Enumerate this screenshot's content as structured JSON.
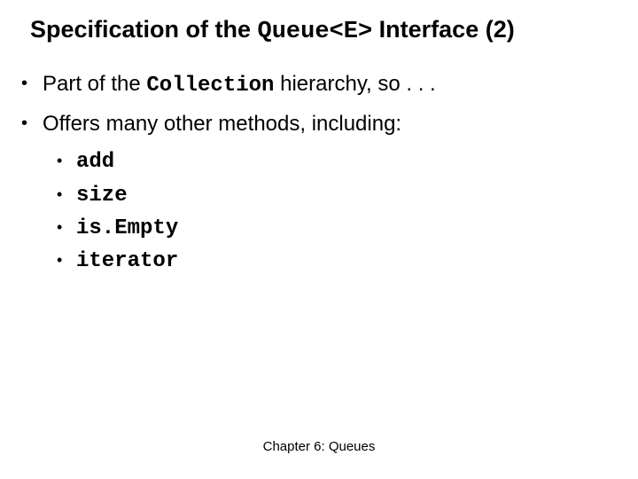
{
  "title": {
    "pre": "Specification of the ",
    "code": "Queue<E>",
    "post": " Interface (2)"
  },
  "bullets": [
    {
      "pre": "Part of the ",
      "code": "Collection",
      "post": " hierarchy, so . . ."
    },
    {
      "pre": "Offers many other methods, including:",
      "code": "",
      "post": ""
    }
  ],
  "subbullets": [
    "add",
    "size",
    "is.Empty",
    "iterator"
  ],
  "footer": "Chapter 6: Queues"
}
